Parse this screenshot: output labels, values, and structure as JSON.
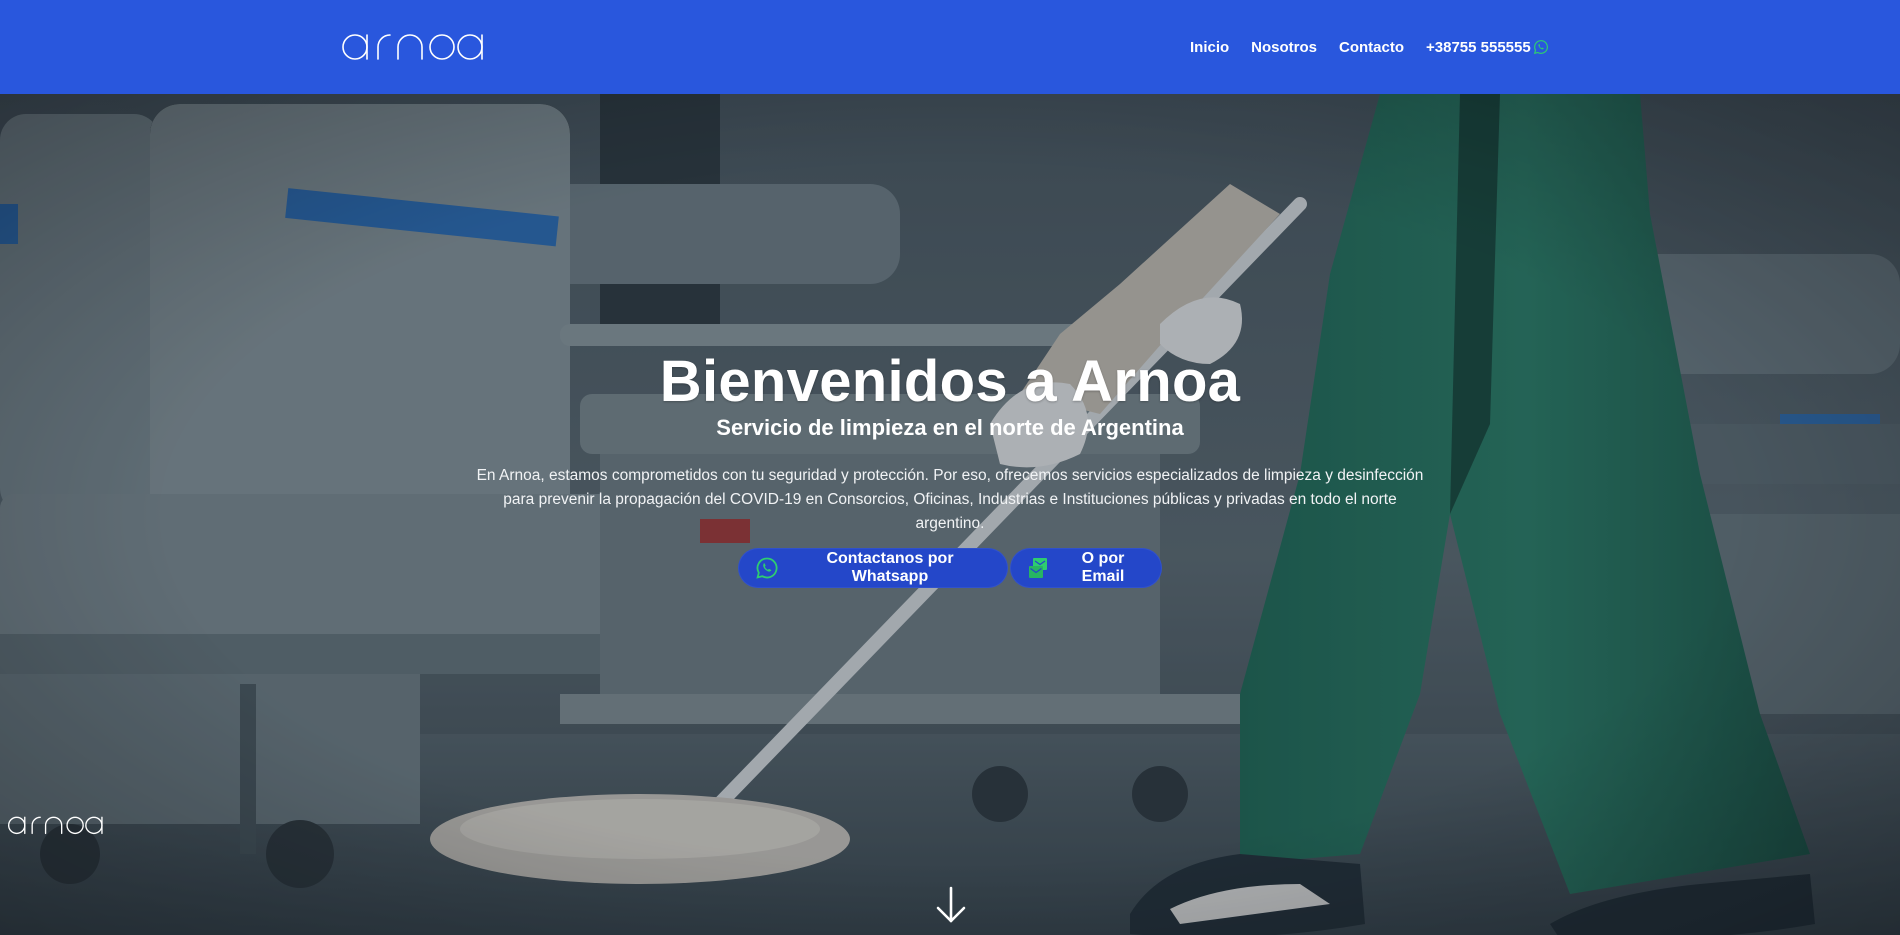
{
  "header": {
    "brand": "arnoa",
    "background": "#2957dd",
    "nav": [
      {
        "label": "Inicio"
      },
      {
        "label": "Nosotros"
      },
      {
        "label": "Contacto"
      }
    ],
    "phone": {
      "label": "+38755 555555",
      "icon": "whatsapp-icon"
    }
  },
  "hero": {
    "background_image": "hospital-cleaner-mopping-floor",
    "title": "Bienvenidos a Arnoa",
    "subtitle": "Servicio de limpieza en el norte de Argentina",
    "text": "En Arnoa, estamos comprometidos con tu seguridad y protección. Por eso, ofrecemos servicios especializados de limpieza y desinfección para prevenir la propagación del COVID-19 en Consorcios, Oficinas, Industrias e Instituciones públicas y privadas en todo el norte argentino.",
    "buttons": [
      {
        "label": "Contactanos por Whatsapp",
        "icon": "whatsapp-icon"
      },
      {
        "label": "O por Email",
        "icon": "email-icon"
      }
    ],
    "button_color": "#2447c9",
    "icon_color": "#2ecc71",
    "scroll_icon": "arrow-down-icon"
  },
  "footer": {
    "logo": "arnoa"
  }
}
